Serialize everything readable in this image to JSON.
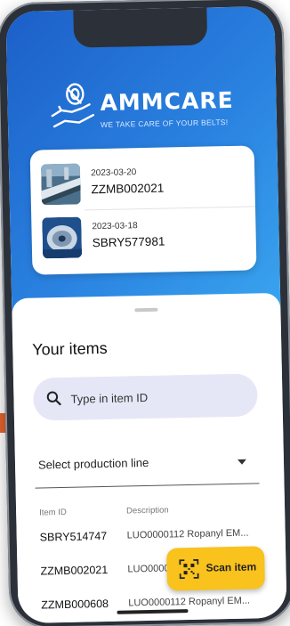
{
  "brand": {
    "name": "AMMCARE",
    "tagline": "WE TAKE CARE OF YOUR BELTS!"
  },
  "recent_items": [
    {
      "date": "2023-03-20",
      "id": "ZZMB002021"
    },
    {
      "date": "2023-03-18",
      "id": "SBRY577981"
    }
  ],
  "sheet": {
    "title": "Your items",
    "search": {
      "placeholder": "Type in item ID"
    },
    "select": {
      "label": "Select production line"
    },
    "table": {
      "columns": [
        "Item ID",
        "Description"
      ],
      "rows": [
        {
          "id": "SBRY514747",
          "desc": "LUO0000112 Ropanyl EM..."
        },
        {
          "id": "ZZMB002021",
          "desc": "LUO0000112 Ropanyl EM..."
        },
        {
          "id": "ZZMB000608",
          "desc": "LUO0000112 Ropanyl EM..."
        }
      ]
    },
    "fab": {
      "label": "Scan item"
    }
  },
  "colors": {
    "hero_start": "#1c5fc8",
    "hero_end": "#3aa6ef",
    "accent": "#f9c21c",
    "search_bg": "#e6e7f6",
    "orange_strip": "#e8632b"
  },
  "icons": {
    "logo": "hand-holding-belt-roll-icon",
    "search": "search-icon",
    "select": "caret-down-icon",
    "fab": "qr-scan-icon"
  }
}
